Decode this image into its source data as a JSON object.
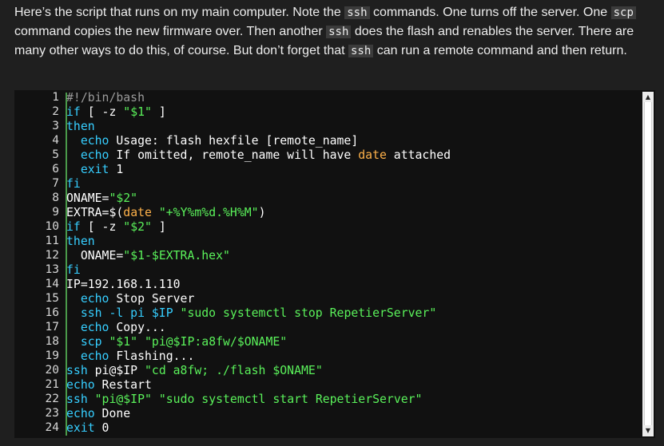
{
  "intro": {
    "t1": "Here’s the script that runs on my main computer. Note the ",
    "c1": "ssh",
    "t2": " commands. One turns off the server. One ",
    "c2": "scp",
    "t3": " command copies the new firmware over. Then another ",
    "c3": "ssh",
    "t4": " does the flash and renables the server. There are many other ways to do this, of course. But don’t forget that ",
    "c4": "ssh",
    "t5": " can run a remote command and then return."
  },
  "code": {
    "line_numbers": [
      "1",
      "2",
      "3",
      "4",
      "5",
      "6",
      "7",
      "8",
      "9",
      "10",
      "11",
      "12",
      "13",
      "14",
      "15",
      "16",
      "17",
      "18",
      "19",
      "20",
      "21",
      "22",
      "23",
      "24"
    ],
    "lines": [
      [
        {
          "t": "#!/bin/bash",
          "c": "comment"
        }
      ],
      [
        {
          "t": "if",
          "c": "kw"
        },
        {
          "t": " [ -z ",
          "c": "plain"
        },
        {
          "t": "\"$1\"",
          "c": "str"
        },
        {
          "t": " ]",
          "c": "plain"
        }
      ],
      [
        {
          "t": "then",
          "c": "kw"
        }
      ],
      [
        {
          "t": "  echo",
          "c": "kw"
        },
        {
          "t": " Usage: flash hexfile [remote_name]",
          "c": "plain"
        }
      ],
      [
        {
          "t": "  echo",
          "c": "kw"
        },
        {
          "t": " If omitted, remote_name will have ",
          "c": "plain"
        },
        {
          "t": "date",
          "c": "fn"
        },
        {
          "t": " attached",
          "c": "plain"
        }
      ],
      [
        {
          "t": "  exit",
          "c": "kw"
        },
        {
          "t": " 1",
          "c": "plain"
        }
      ],
      [
        {
          "t": "fi",
          "c": "kw"
        }
      ],
      [
        {
          "t": "ONAME=",
          "c": "plain"
        },
        {
          "t": "\"$2\"",
          "c": "str"
        }
      ],
      [
        {
          "t": "EXTRA=$(",
          "c": "plain"
        },
        {
          "t": "date",
          "c": "fn"
        },
        {
          "t": " ",
          "c": "plain"
        },
        {
          "t": "\"+%Y%m%d.%H%M\"",
          "c": "str"
        },
        {
          "t": ")",
          "c": "plain"
        }
      ],
      [
        {
          "t": "if",
          "c": "kw"
        },
        {
          "t": " [ -z ",
          "c": "plain"
        },
        {
          "t": "\"$2\"",
          "c": "str"
        },
        {
          "t": " ]",
          "c": "plain"
        }
      ],
      [
        {
          "t": "then",
          "c": "kw"
        }
      ],
      [
        {
          "t": "  ONAME=",
          "c": "plain"
        },
        {
          "t": "\"$1-$EXTRA.hex\"",
          "c": "str"
        }
      ],
      [
        {
          "t": "fi",
          "c": "kw"
        }
      ],
      [
        {
          "t": "IP=192.168.1.110",
          "c": "plain"
        }
      ],
      [
        {
          "t": "  echo",
          "c": "kw"
        },
        {
          "t": " Stop Server",
          "c": "plain"
        }
      ],
      [
        {
          "t": "  ssh -l pi $IP ",
          "c": "kw"
        },
        {
          "t": "\"sudo systemctl stop RepetierServer\"",
          "c": "str"
        }
      ],
      [
        {
          "t": "  echo",
          "c": "kw"
        },
        {
          "t": " Copy...",
          "c": "plain"
        }
      ],
      [
        {
          "t": "  scp ",
          "c": "kw"
        },
        {
          "t": "\"$1\"",
          "c": "str"
        },
        {
          "t": " ",
          "c": "plain"
        },
        {
          "t": "\"pi@$IP:a8fw/$ONAME\"",
          "c": "str"
        }
      ],
      [
        {
          "t": "  echo",
          "c": "kw"
        },
        {
          "t": " Flashing...",
          "c": "plain"
        }
      ],
      [
        {
          "t": "ssh",
          "c": "kw"
        },
        {
          "t": " pi@$IP ",
          "c": "plain"
        },
        {
          "t": "\"cd a8fw; ./flash $ONAME\"",
          "c": "str"
        }
      ],
      [
        {
          "t": "echo",
          "c": "kw"
        },
        {
          "t": " Restart",
          "c": "plain"
        }
      ],
      [
        {
          "t": "ssh ",
          "c": "kw"
        },
        {
          "t": "\"pi@$IP\"",
          "c": "str"
        },
        {
          "t": " ",
          "c": "plain"
        },
        {
          "t": "\"sudo systemctl start RepetierServer\"",
          "c": "str"
        }
      ],
      [
        {
          "t": "echo",
          "c": "kw"
        },
        {
          "t": " Done",
          "c": "plain"
        }
      ],
      [
        {
          "t": "exit",
          "c": "kw"
        },
        {
          "t": " 0",
          "c": "plain"
        }
      ]
    ]
  },
  "scrollbar": {
    "up_icon": "triangle-up-icon",
    "down_icon": "triangle-down-icon"
  }
}
